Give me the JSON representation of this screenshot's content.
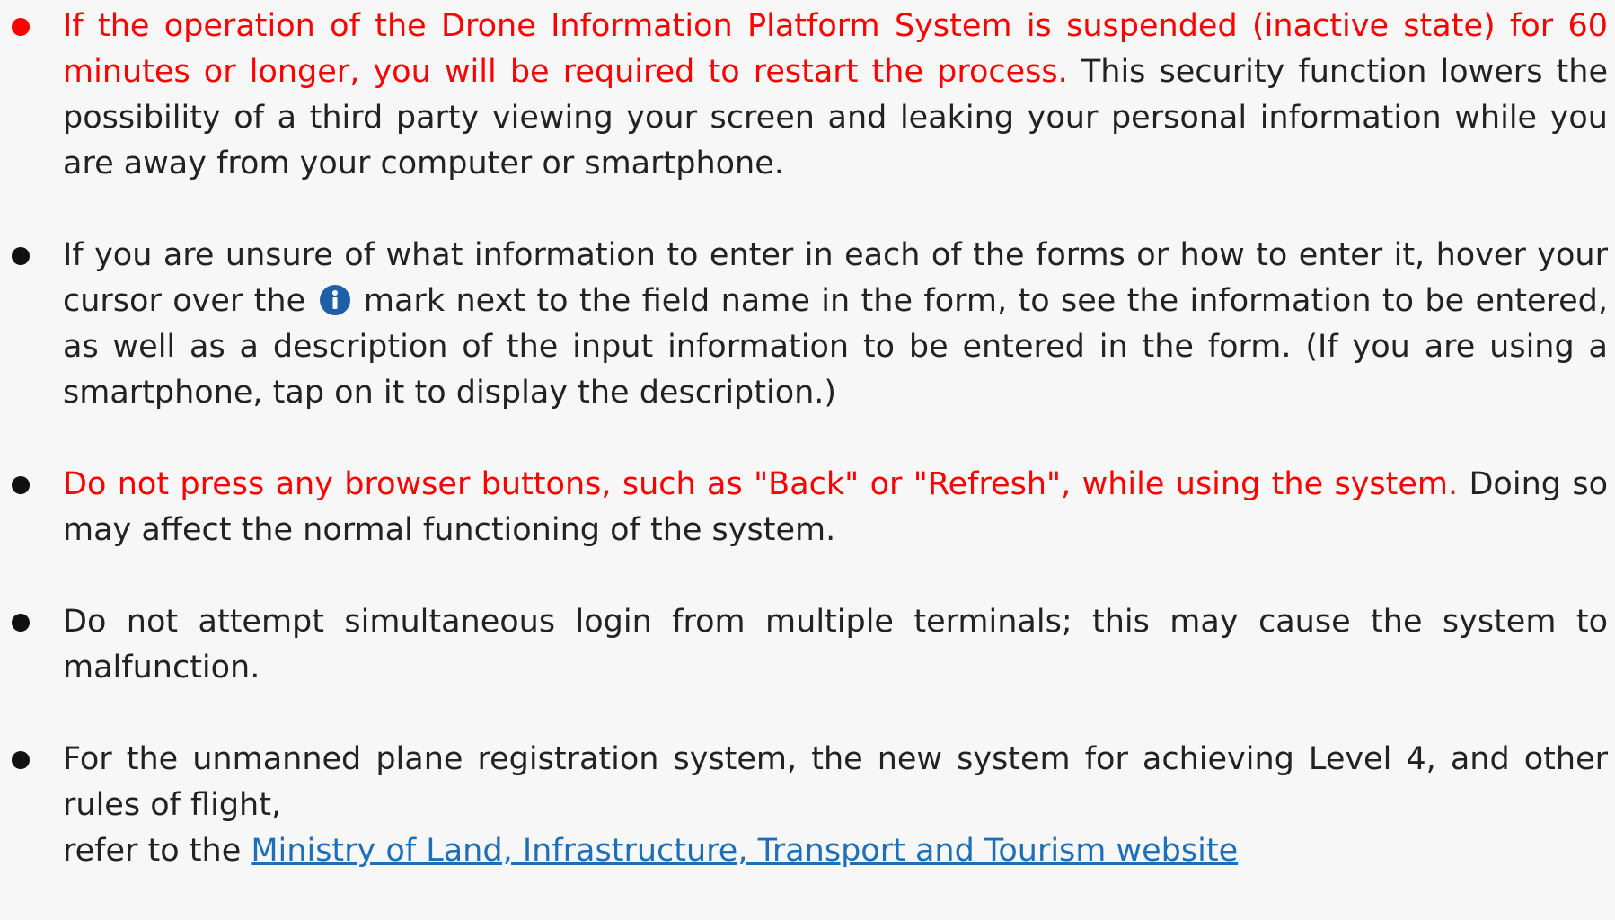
{
  "notices": [
    {
      "warning": "If the operation of the Drone Information Platform System is suspended (inactive state) for 60 minutes or longer, you will be required to restart the process.",
      "text": " This security function lowers the possibility of a third party viewing your screen and leaking your personal information while you are away from your computer or smartphone."
    },
    {
      "text_before_icon": "If you are unsure of what information to enter in each of the forms or how to enter it, hover your cursor over the ",
      "icon": "info-icon",
      "text_after_icon": " mark next to the field name in the form, to see the information to be entered, as well as a description of the input information to be entered in the form. (If you are using a smartphone, tap on it to display the description.)"
    },
    {
      "warning": "Do not press any browser buttons, such as \"Back\" or \"Refresh\", while using the system.",
      "text": "Doing so may affect the normal functioning of the system."
    },
    {
      "text": "Do not attempt simultaneous login from multiple terminals; this may cause the system to malfunction."
    },
    {
      "text": "For the unmanned plane registration system, the new system for achieving Level 4, and other rules of flight,",
      "refer_prefix": "refer to the ",
      "link_label": "Ministry of Land, Infrastructure, Transport and Tourism website"
    }
  ],
  "colors": {
    "warning": "#ff0000",
    "link": "#1e6fb8",
    "info_icon": "#1f5fa8"
  }
}
